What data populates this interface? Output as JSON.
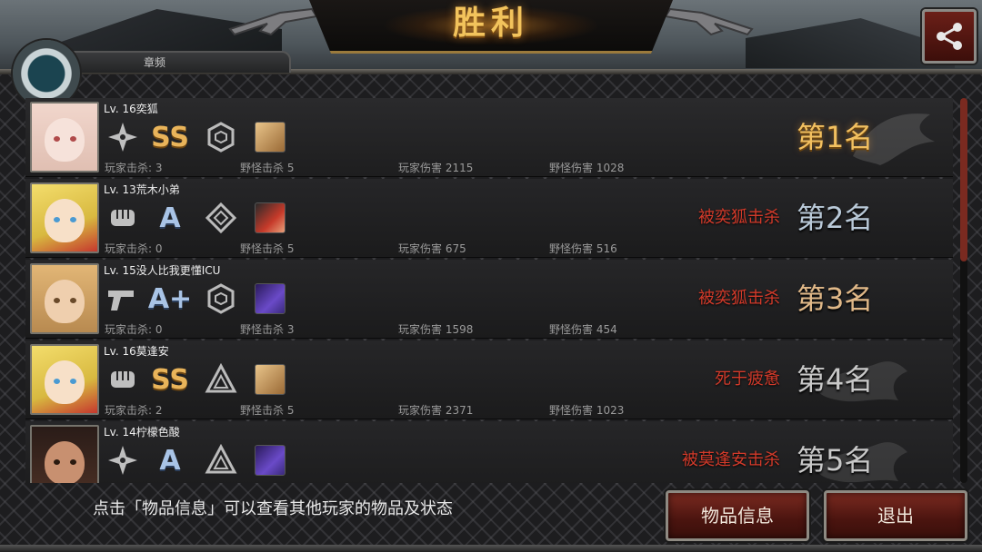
{
  "banner": {
    "title": "胜利"
  },
  "top_tab_label": "章频",
  "icons": {
    "share": "share-icon"
  },
  "players": [
    {
      "level_name": "Lv. 16奕狐",
      "skills": [
        "shuriken-icon",
        "grade-SS",
        "hexagon-sigil-icon",
        "item-box"
      ],
      "grade": "SS",
      "stats": {
        "player_kills": "玩家击杀: 3",
        "monster_kills": "野怪击杀 5",
        "player_damage": "玩家伤害 2115",
        "monster_damage": "野怪伤害 1028"
      },
      "death": "",
      "rank": "第1名"
    },
    {
      "level_name": "Lv. 13荒木小弟",
      "skills": [
        "fist-icon",
        "grade-A",
        "diamond-sigil-icon",
        "item-face"
      ],
      "grade": "A",
      "stats": {
        "player_kills": "玩家击杀: 0",
        "monster_kills": "野怪击杀 5",
        "player_damage": "玩家伤害 675",
        "monster_damage": "野怪伤害 516"
      },
      "death": "被奕狐击杀",
      "rank": "第2名"
    },
    {
      "level_name": "Lv. 15没人比我更懂ICU",
      "skills": [
        "pistol-icon",
        "grade-A+",
        "hexagon-sigil-icon",
        "item-purple"
      ],
      "grade": "A+",
      "stats": {
        "player_kills": "玩家击杀: 0",
        "monster_kills": "野怪击杀 3",
        "player_damage": "玩家伤害 1598",
        "monster_damage": "野怪伤害 454"
      },
      "death": "被奕狐击杀",
      "rank": "第3名"
    },
    {
      "level_name": "Lv. 16莫逢安",
      "skills": [
        "fist-icon",
        "grade-SS",
        "triangle-sigil-icon",
        "item-box"
      ],
      "grade": "SS",
      "stats": {
        "player_kills": "玩家击杀: 2",
        "monster_kills": "野怪击杀 5",
        "player_damage": "玩家伤害 2371",
        "monster_damage": "野怪伤害 1023"
      },
      "death": "死于疲惫",
      "rank": "第4名"
    },
    {
      "level_name": "Lv. 14柠檬色酸",
      "skills": [
        "shuriken-icon",
        "grade-A",
        "triangle-sigil-icon",
        "item-purple"
      ],
      "grade": "A",
      "stats": {
        "player_kills": "",
        "monster_kills": "",
        "player_damage": "",
        "monster_damage": ""
      },
      "death": "被莫逢安击杀",
      "rank": "第5名"
    }
  ],
  "footer": {
    "hint": "点击「物品信息」可以查看其他玩家的物品及状态",
    "items_button": "物品信息",
    "exit_button": "退出"
  },
  "colors": {
    "gold": "#f2c060",
    "kill_red": "#d23a2a",
    "button_red": "#7a2a20"
  }
}
